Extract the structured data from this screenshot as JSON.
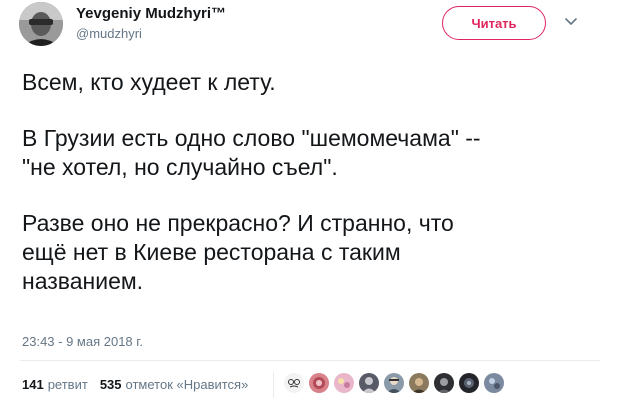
{
  "author": {
    "name": "Yevgeniy Mudzhyri™",
    "handle": "@mudzhyri",
    "avatar_icon": "user-avatar"
  },
  "follow_button": {
    "label": "Читать",
    "color": "#e0245e"
  },
  "menu_icon": "chevron-down-icon",
  "tweet": {
    "p1": "Всем, кто худеет к лету.",
    "p2_line1": "В Грузии есть одно слово \"шемомечама\" --",
    "p2_line2": "\"не хотел, но случайно съел\".",
    "p3_line1": "Разве оно не прекрасно? И странно, что",
    "p3_line2": "ещё нет в Киеве ресторана с таким",
    "p3_line3": "названием."
  },
  "timestamp": "23:43 - 9 мая 2018 г.",
  "stats": {
    "retweets_count": "141",
    "retweets_label": "ретвит",
    "likes_count": "535",
    "likes_label": "отметок «Нравится»"
  },
  "likers": [
    {
      "icon": "liker-avatar-1",
      "color": "#f3f3f3"
    },
    {
      "icon": "liker-avatar-2",
      "color": "#d9828a"
    },
    {
      "icon": "liker-avatar-3",
      "color": "#e9b7c9"
    },
    {
      "icon": "liker-avatar-4",
      "color": "#585a66"
    },
    {
      "icon": "liker-avatar-5",
      "color": "#8b9aa8"
    },
    {
      "icon": "liker-avatar-6",
      "color": "#8c7a5e"
    },
    {
      "icon": "liker-avatar-7",
      "color": "#2e2f33"
    },
    {
      "icon": "liker-avatar-8",
      "color": "#23252b"
    },
    {
      "icon": "liker-avatar-9",
      "color": "#7c8aa0"
    }
  ]
}
